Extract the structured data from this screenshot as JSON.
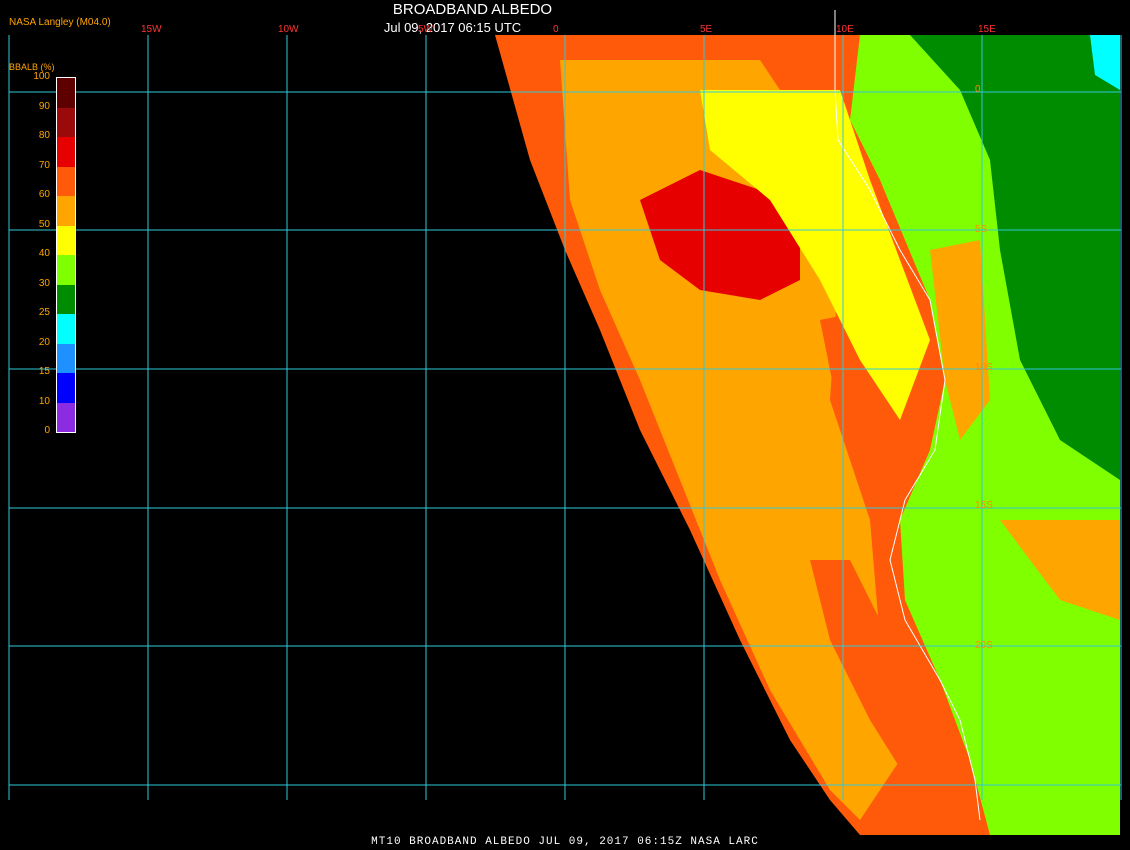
{
  "header": {
    "title": "BROADBAND ALBEDO",
    "subtitle": "Jul 09, 2017 06:15 UTC",
    "producer": "NASA Langley (M04.0)"
  },
  "footer": "MT10  BROADBAND ALBEDO   JUL 09, 2017 06:15Z   NASA LARC",
  "colorbar": {
    "title": "BBALB (%)",
    "ticks": [
      "100",
      "90",
      "80",
      "70",
      "60",
      "50",
      "40",
      "30",
      "25",
      "20",
      "15",
      "10",
      "0"
    ],
    "colors": [
      "#5e0000",
      "#9a0a0a",
      "#e60000",
      "#ff5a0a",
      "#ffa500",
      "#ffff00",
      "#7fff00",
      "#008c00",
      "#00ffff",
      "#1e90ff",
      "#0000ff",
      "#8b2be2"
    ]
  },
  "grid": {
    "line_color": "#30c8d8",
    "lon_labels": [
      "15W",
      "10W",
      "5W",
      "0",
      "5E",
      "10E",
      "15E"
    ],
    "lat_labels": [
      "0",
      "5S",
      "10S",
      "15S",
      "20S"
    ]
  },
  "map_colors": {
    "space": "#000000",
    "coast": "#ffffff",
    "albedo_dark_red": "#9a0a0a",
    "albedo_red": "#e60000",
    "albedo_orange_red": "#ff5a0a",
    "albedo_orange": "#ffa500",
    "albedo_yellow": "#ffff00",
    "albedo_lime": "#7fff00",
    "albedo_green": "#008c00",
    "albedo_cyan": "#00ffff"
  }
}
